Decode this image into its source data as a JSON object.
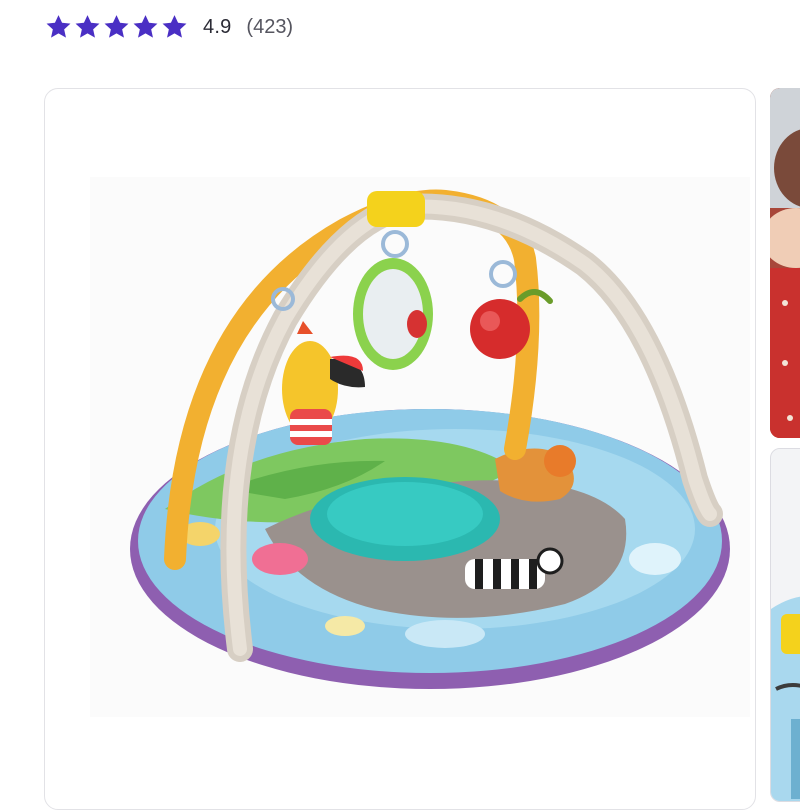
{
  "rating": {
    "stars_filled": 5,
    "stars_total": 5,
    "score": "4.9",
    "review_count": "(423)",
    "star_color": "#4a2fc4"
  },
  "gallery": {
    "main_image": {
      "subject": "baby-activity-gym-play-mat"
    },
    "thumbnails": [
      {
        "subject": "baby-on-red-blanket"
      },
      {
        "subject": "play-mat-closeup"
      }
    ]
  },
  "icons": {
    "star": "star-icon"
  }
}
